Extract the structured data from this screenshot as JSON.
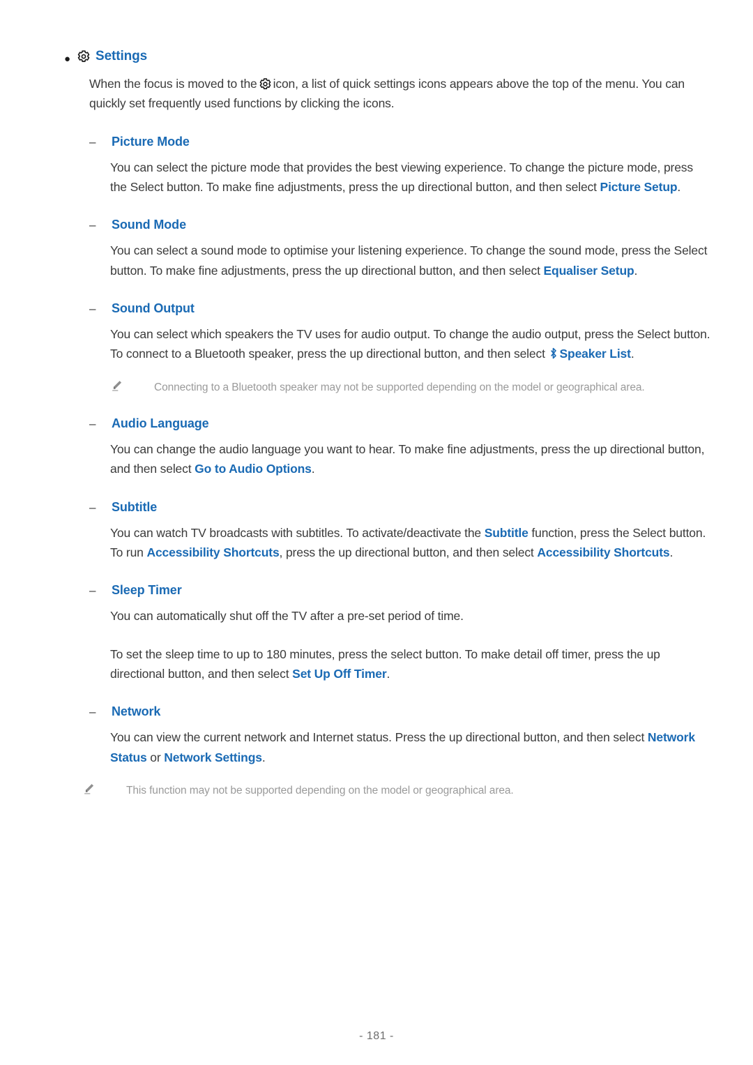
{
  "document": {
    "page_number_label": "- 181 -",
    "link_color": "#1a6ab4",
    "body_color": "#3b3b3b",
    "note_color": "#9a9a9a"
  },
  "section": {
    "bullet_marker": "●",
    "title": "Settings",
    "gear_icon_name": "gear-icon",
    "intro_part1": "When the focus is moved to the",
    "intro_part2": "icon, a list of quick settings icons appears above the top of the menu. You can quickly set frequently used functions by clicking the icons."
  },
  "items": [
    {
      "dash": "–",
      "title": "Picture Mode",
      "body": [
        {
          "text": "You can select the picture mode that provides the best viewing experience. To change the picture mode, press the Select button. To make fine adjustments, press the up directional button, and then select ",
          "link": "Picture Setup",
          "tail": "."
        }
      ]
    },
    {
      "dash": "–",
      "title": "Sound Mode",
      "body": [
        {
          "text": "You can select a sound mode to optimise your listening experience. To change the sound mode, press the Select button. To make fine adjustments, press the up directional button, and then select ",
          "link": "Equaliser Setup",
          "tail": "."
        }
      ]
    },
    {
      "dash": "–",
      "title": "Sound Output",
      "body": [
        {
          "text": "You can select which speakers the TV uses for audio output. To change the audio output, press the Select button. To connect to a Bluetooth speaker, press the up directional button, and then select ",
          "link": "Speaker List",
          "tail": ".",
          "bluetooth_icon": true
        }
      ],
      "note": "Connecting to a Bluetooth speaker may not be supported depending on the model or geographical area."
    },
    {
      "dash": "–",
      "title": "Audio Language",
      "body": [
        {
          "text": "You can change the audio language you want to hear. To make fine adjustments, press the up directional button, and then select ",
          "link": "Go to Audio Options",
          "tail": "."
        }
      ]
    },
    {
      "dash": "–",
      "title": "Subtitle",
      "body": [
        {
          "text_a": "You can watch TV broadcasts with subtitles. To activate/deactivate the ",
          "link_a": "Subtitle",
          "text_b": " function, press the Select button. To run ",
          "link_b": "Accessibility Shortcuts",
          "text_c": ", press the up directional button, and then select ",
          "link_c": "Accessibility Shortcuts",
          "tail": "."
        }
      ]
    },
    {
      "dash": "–",
      "title": "Sleep Timer",
      "body": [
        {
          "text": "You can automatically shut off the TV after a pre-set period of time."
        },
        {
          "text": "To set the sleep time to up to 180 minutes, press the select button. To make detail off timer, press the up directional button, and then select ",
          "link": "Set Up Off Timer",
          "tail": "."
        }
      ]
    },
    {
      "dash": "–",
      "title": "Network",
      "body": [
        {
          "text_a": "You can view the current network and Internet status. Press the up directional button, and then select ",
          "link_a": "Network Status",
          "text_b": " or ",
          "link_b": "Network Settings",
          "tail": "."
        }
      ],
      "note_outer": "This function may not be supported depending on the model or geographical area."
    }
  ]
}
